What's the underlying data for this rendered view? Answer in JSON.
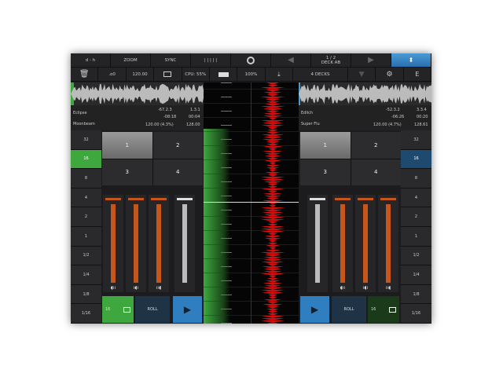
{
  "top": {
    "dash": "d - h",
    "zoom": "ZOOM",
    "sync": "SYNC",
    "bars": "| | | | |",
    "page": "1 / 2",
    "deck": "DECK AB"
  },
  "second": {
    "key": ".o0",
    "bpm": "120.00",
    "cpu": "CPU: 55%",
    "battery": "100%",
    "decks": "4 DECKS",
    "e": "E"
  },
  "left": {
    "title": "Eclipse",
    "artist": "Moonbeam",
    "pos": "-67.2.3",
    "beat": "1.3.1",
    "remain": "-08:18",
    "elapsed": "00:04",
    "tempo": "120.00 (4.3%)",
    "orig": "128.00",
    "loops": [
      "32",
      "16",
      "8",
      "4",
      "2",
      "1",
      "1/2",
      "1/4",
      "1/8",
      "1/16"
    ],
    "active_loop": 1,
    "pads": [
      "1",
      "2",
      "3",
      "4"
    ],
    "loop_btn": "16",
    "roll": "ROLL"
  },
  "right": {
    "title": "Edlich",
    "artist": "Super Flu",
    "pos": "-52.3.2",
    "beat": "3.3.4",
    "remain": "-06:26",
    "elapsed": "00:20",
    "tempo": "120.00 (4.7%)",
    "orig": "128.61",
    "loops": [
      "32",
      "16",
      "8",
      "4",
      "2",
      "1",
      "1/2",
      "1/4",
      "1/8",
      "1/16"
    ],
    "active_loop": 1,
    "pads": [
      "1",
      "2",
      "3",
      "4"
    ],
    "loop_btn": "16",
    "roll": "ROLL"
  },
  "colors": {
    "accent": "#2a6fae",
    "green": "#3ea83e",
    "orange": "#c8561a",
    "red": "#d01010"
  }
}
